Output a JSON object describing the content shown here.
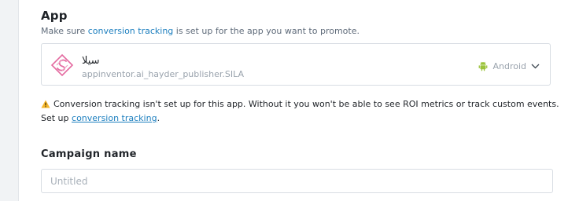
{
  "app_section": {
    "title": "App",
    "description_prefix": "Make sure ",
    "description_link": "conversion tracking",
    "description_suffix": " is set up for the app you want to promote."
  },
  "app_select": {
    "logo_icon": "sila-app-logo-icon",
    "app_name": "سيلا",
    "app_package": "appinventor.ai_hayder_publisher.SILA",
    "platform_icon": "android-icon",
    "platform_label": "Android",
    "dropdown_icon": "chevron-down-icon"
  },
  "warning": {
    "icon": "warning-triangle-icon",
    "text_prefix": "Conversion tracking isn't set up for this app. Without it you won't be able to see ROI metrics or track custom events. Set up ",
    "link": "conversion tracking",
    "text_suffix": "."
  },
  "campaign_name": {
    "label": "Campaign name",
    "value": "",
    "placeholder": "Untitled"
  },
  "colors": {
    "link": "#1d7fbf",
    "android_green": "#9bc33b",
    "warning_yellow": "#f5b72d",
    "logo_pink": "#e46aa0"
  }
}
